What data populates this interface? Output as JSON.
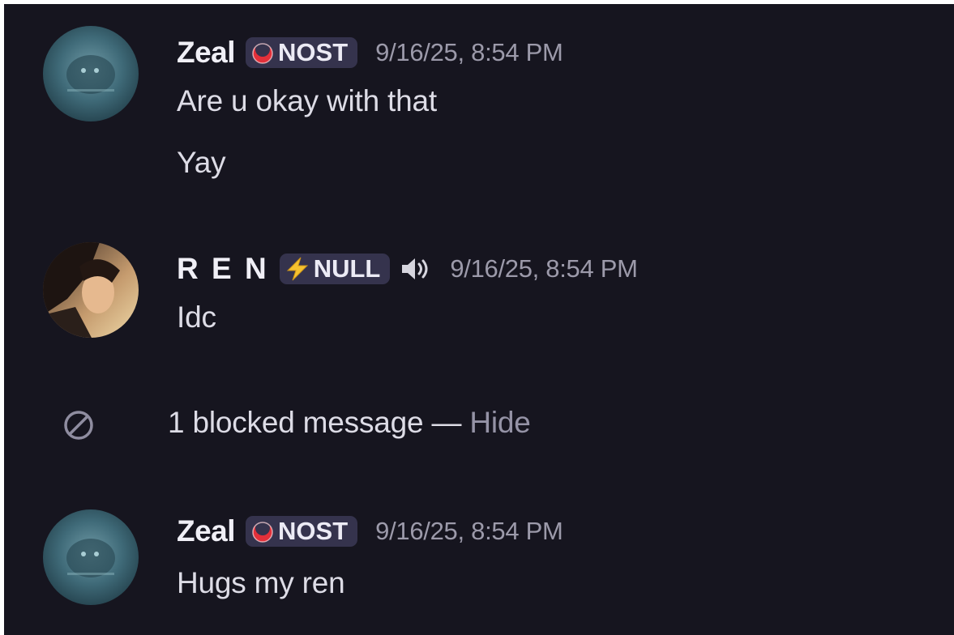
{
  "messages": [
    {
      "username": "Zeal",
      "tag": "NOST",
      "tag_icon": "red-moon-emblem-icon",
      "timestamp": "9/16/25, 8:54 PM",
      "lines": [
        "Are u okay with that",
        "Yay"
      ]
    },
    {
      "username": "R E N",
      "tag": "NULL",
      "tag_icon": "lightning-bolt-icon",
      "status_icon": "speaker-icon",
      "timestamp": "9/16/25, 8:54 PM",
      "lines": [
        "Idc"
      ]
    },
    {
      "username": "Zeal",
      "tag": "NOST",
      "tag_icon": "red-moon-emblem-icon",
      "timestamp": "9/16/25, 8:54 PM",
      "lines": [
        "Hugs my ren"
      ]
    }
  ],
  "blocked": {
    "text": "1 blocked message — ",
    "hide_label": "Hide",
    "icon": "blocked-icon"
  },
  "colors": {
    "background": "#16151f",
    "tag_background": "#35334d",
    "timestamp": "#9c9aaa",
    "lightning": "#f6c22f",
    "nost_emblem": "#e2303a"
  }
}
